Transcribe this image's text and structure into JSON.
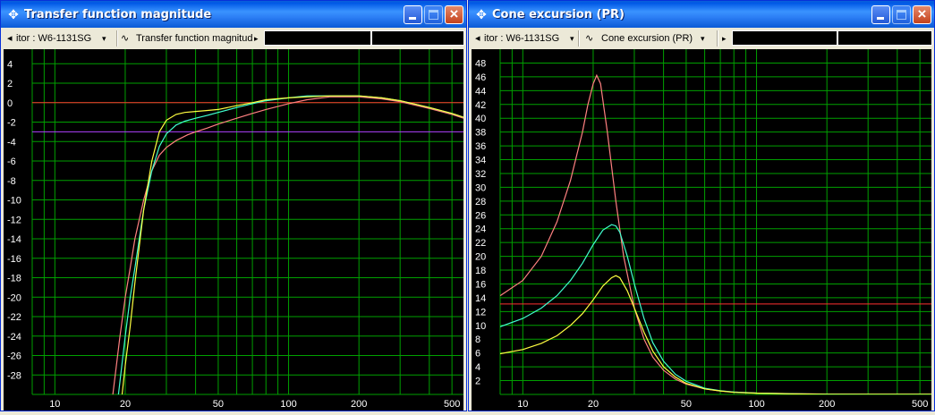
{
  "windows": [
    {
      "id": "left",
      "title": "Transfer function magnitude",
      "title_icon": "crosshair-icon",
      "toolbar": {
        "driver_label": "itor : W6-1131SG",
        "curve_label": "Transfer function magnitude"
      },
      "chart_data": {
        "type": "line",
        "x_scale": "log",
        "xlim": [
          8,
          560
        ],
        "ylim": [
          -30,
          5.5
        ],
        "x_ticks": [
          10,
          20,
          50,
          100,
          200,
          500
        ],
        "y_ticks": [
          4,
          2,
          0,
          -2,
          -4,
          -6,
          -8,
          -10,
          -12,
          -14,
          -16,
          -18,
          -20,
          -22,
          -24,
          -26,
          -28
        ],
        "hlines": [
          {
            "y": 0,
            "color": "#ff3030"
          },
          {
            "y": -3,
            "color": "#b040ff"
          }
        ],
        "series": [
          {
            "color": "#ff8080",
            "x": [
              17.5,
              19,
              20,
              21,
              22,
              24,
              26,
              28,
              30,
              33,
              37,
              40,
              45,
              50,
              60,
              70,
              80,
              100,
              120,
              150,
              180,
              200,
              250,
              300,
              400,
              500,
              560
            ],
            "y": [
              -31,
              -24,
              -20,
              -17,
              -14,
              -10,
              -7,
              -5.4,
              -4.6,
              -3.9,
              -3.3,
              -3,
              -2.6,
              -2.2,
              -1.6,
              -1.1,
              -0.7,
              -0.1,
              0.3,
              0.6,
              0.6,
              0.6,
              0.4,
              0.1,
              -0.6,
              -1.2,
              -1.6
            ]
          },
          {
            "color": "#40ffd0",
            "x": [
              18.5,
              20,
              21,
              22,
              24,
              26,
              28,
              30,
              33,
              36,
              40,
              45,
              50,
              60,
              70,
              80,
              100,
              120,
              150,
              180,
              200,
              250,
              300,
              400,
              500,
              560
            ],
            "y": [
              -31,
              -24,
              -20,
              -17,
              -11,
              -7,
              -4.5,
              -3.2,
              -2.3,
              -1.9,
              -1.6,
              -1.3,
              -1,
              -0.5,
              -0.1,
              0.2,
              0.5,
              0.7,
              0.7,
              0.7,
              0.7,
              0.5,
              0.2,
              -0.5,
              -1.1,
              -1.5
            ]
          },
          {
            "color": "#ffff40",
            "x": [
              19.2,
              20,
              21,
              22,
              24,
              26,
              28,
              30,
              33,
              36,
              40,
              45,
              50,
              60,
              70,
              80,
              100,
              120,
              150,
              180,
              200,
              250,
              300,
              400,
              500,
              560
            ],
            "y": [
              -31,
              -27,
              -23,
              -18.5,
              -11,
              -6,
              -3,
              -1.8,
              -1.2,
              -1,
              -0.9,
              -0.8,
              -0.7,
              -0.3,
              0,
              0.3,
              0.5,
              0.6,
              0.7,
              0.7,
              0.7,
              0.5,
              0.2,
              -0.5,
              -1.1,
              -1.5
            ]
          }
        ]
      }
    },
    {
      "id": "right",
      "title": "Cone excursion (PR)",
      "title_icon": "crosshair-icon",
      "toolbar": {
        "driver_label": "itor : W6-1131SG",
        "curve_label": "Cone excursion (PR)"
      },
      "chart_data": {
        "type": "line",
        "x_scale": "log",
        "xlim": [
          8,
          560
        ],
        "ylim": [
          0,
          50
        ],
        "x_ticks": [
          10,
          20,
          50,
          100,
          200,
          500
        ],
        "y_ticks": [
          48,
          46,
          44,
          42,
          40,
          38,
          36,
          34,
          32,
          30,
          28,
          26,
          24,
          22,
          20,
          18,
          16,
          14,
          12,
          10,
          8,
          6,
          4,
          2
        ],
        "hlines": [
          {
            "y": 13.1,
            "color": "#ff3030"
          }
        ],
        "series": [
          {
            "color": "#ff8080",
            "x": [
              8,
              10,
              12,
              14,
              16,
              18,
              19,
              20,
              20.7,
              21.5,
              23,
              25,
              27,
              30,
              33,
              36,
              40,
              45,
              50,
              60,
              70,
              80,
              100,
              150,
              200,
              300,
              500,
              560
            ],
            "y": [
              14.3,
              16.5,
              20,
              25,
              31,
              38,
              42,
              45,
              46.2,
              45,
              38,
              28,
              20,
              12.5,
              8,
              5.4,
              3.5,
              2.2,
              1.5,
              0.8,
              0.5,
              0.35,
              0.2,
              0.1,
              0.05,
              0.02,
              0.01,
              0.01
            ]
          },
          {
            "color": "#40ffd0",
            "x": [
              8,
              10,
              12,
              14,
              16,
              18,
              20,
              22,
              24,
              25,
              26,
              28,
              30,
              33,
              36,
              40,
              45,
              50,
              60,
              70,
              80,
              100,
              150,
              200,
              300,
              500,
              560
            ],
            "y": [
              9.8,
              11,
              12.5,
              14.3,
              16.5,
              19,
              21.7,
              23.8,
              24.6,
              24.4,
              23.5,
              20,
              16,
              11,
              7.5,
              4.8,
              2.9,
              1.9,
              0.9,
              0.55,
              0.35,
              0.2,
              0.08,
              0.04,
              0.02,
              0.01,
              0.01
            ]
          },
          {
            "color": "#ffff40",
            "x": [
              8,
              10,
              12,
              14,
              16,
              18,
              20,
              22,
              24,
              25,
              26,
              28,
              30,
              33,
              36,
              40,
              45,
              50,
              60,
              70,
              80,
              100,
              150,
              200,
              300,
              500,
              560
            ],
            "y": [
              5.9,
              6.5,
              7.4,
              8.5,
              10,
              11.7,
              13.7,
              15.7,
              16.9,
              17.2,
              16.9,
              15,
              12.5,
              9,
              6.3,
              4,
              2.5,
              1.6,
              0.8,
              0.5,
              0.3,
              0.18,
              0.07,
              0.03,
              0.02,
              0.01,
              0.01
            ]
          }
        ]
      }
    }
  ]
}
